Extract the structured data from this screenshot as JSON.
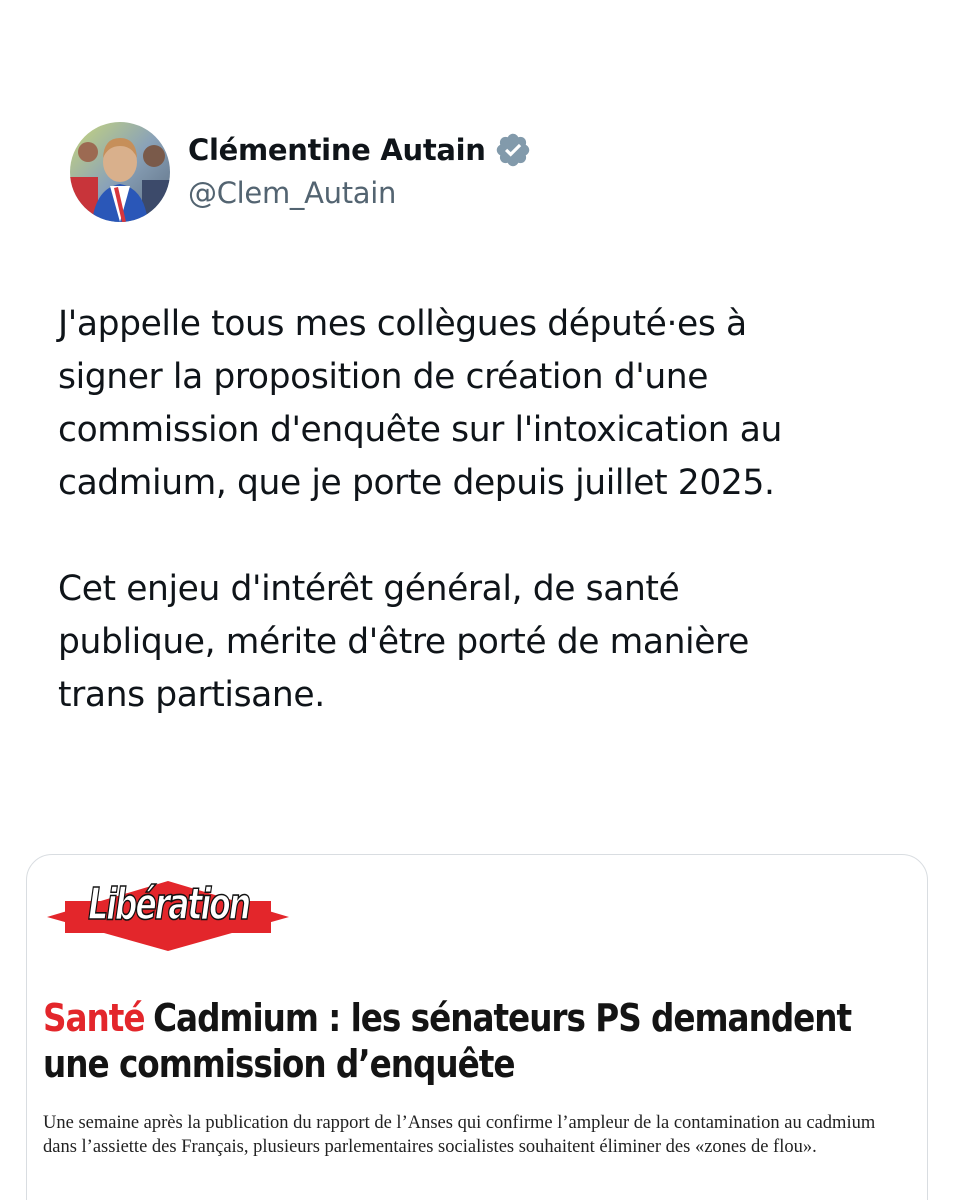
{
  "tweet": {
    "author_name": "Clémentine Autain",
    "handle": "@Clem_Autain",
    "verified_icon": "verified-badge-icon",
    "paragraphs": [
      "J'appelle tous mes collègues député·es à\nsigner la proposition de création d'une\ncommission d'enquête sur l'intoxication au\ncadmium, que je porte depuis juillet 2025.",
      "Cet enjeu d'intérêt général, de santé\npublique, mérite d'être porté de manière\ntrans partisane."
    ]
  },
  "article": {
    "source_logo_text": "Libération",
    "rubric": "Santé",
    "title": "Cadmium : les sénateurs PS demandent une commission d’enquête",
    "lede": "Une semaine après la publication du rapport de l’Anses qui confirme l’ampleur de la contamination au cadmium dans l’assiette des Français, plusieurs parlementaires socialistes souhaitent éliminer des «zones de flou»."
  },
  "colors": {
    "text_primary": "#0f1419",
    "text_secondary": "#536471",
    "verified_gray": "#829aab",
    "liberation_red": "#e3262b",
    "card_border": "#d9dde1"
  }
}
